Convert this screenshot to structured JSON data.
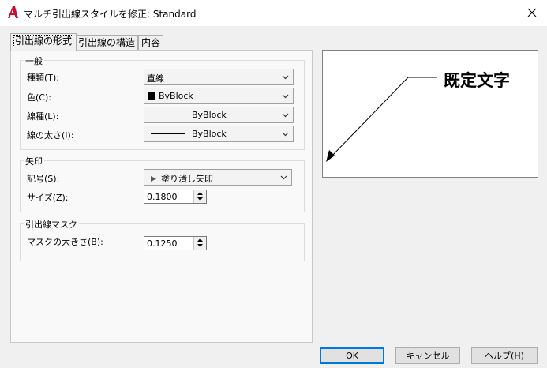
{
  "window": {
    "title": "マルチ引出線スタイルを修正: Standard",
    "app_icon": "autocad-a-icon",
    "close_icon": "close-icon"
  },
  "tabs": [
    {
      "label": "引出線の形式",
      "active": true
    },
    {
      "label": "引出線の構造",
      "active": false
    },
    {
      "label": "内容",
      "active": false
    }
  ],
  "general": {
    "title": "一般",
    "type_label": "種類(T):",
    "type_value": "直線",
    "color_label": "色(C):",
    "color_value": "ByBlock",
    "linetype_label": "線種(L):",
    "linetype_value": "ByBlock",
    "lineweight_label": "線の太さ(I):",
    "lineweight_value": "ByBlock"
  },
  "arrowhead": {
    "title": "矢印",
    "symbol_label": "記号(S):",
    "symbol_value": "塗り潰し矢印",
    "size_label": "サイズ(Z):",
    "size_value": "0.1800"
  },
  "leader_mask": {
    "title": "引出線マスク",
    "mask_size_label": "マスクの大きさ(B):",
    "mask_size_value": "0.1250"
  },
  "preview": {
    "text": "既定文字"
  },
  "buttons": {
    "ok": "OK",
    "cancel": "キャンセル",
    "help": "ヘルプ(H)"
  },
  "colors": {
    "accent": "#0078d7",
    "brand_red": "#c8102e"
  }
}
